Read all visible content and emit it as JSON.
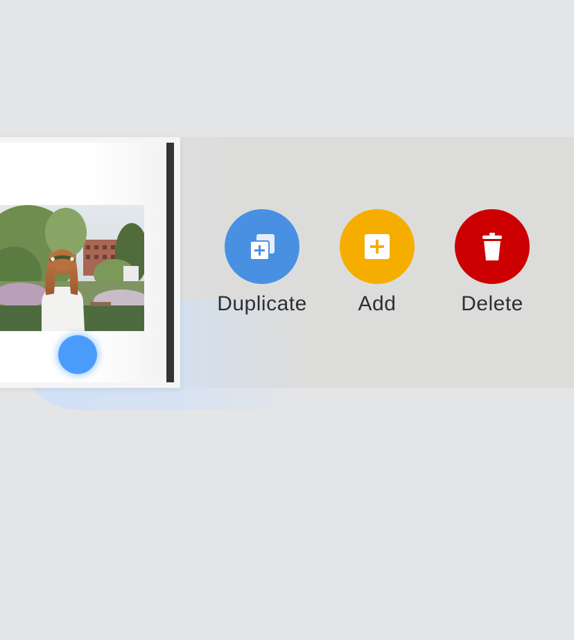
{
  "actions": {
    "duplicate": {
      "label": "Duplicate",
      "icon": "duplicate-icon",
      "color": "#4a90e2"
    },
    "add": {
      "label": "Add",
      "icon": "add-page-icon",
      "color": "#f5ae00"
    },
    "delete": {
      "label": "Delete",
      "icon": "trash-icon",
      "color": "#cc0000"
    }
  },
  "page_card": {
    "image": "photo of a woman with a flower crown in a garden"
  }
}
